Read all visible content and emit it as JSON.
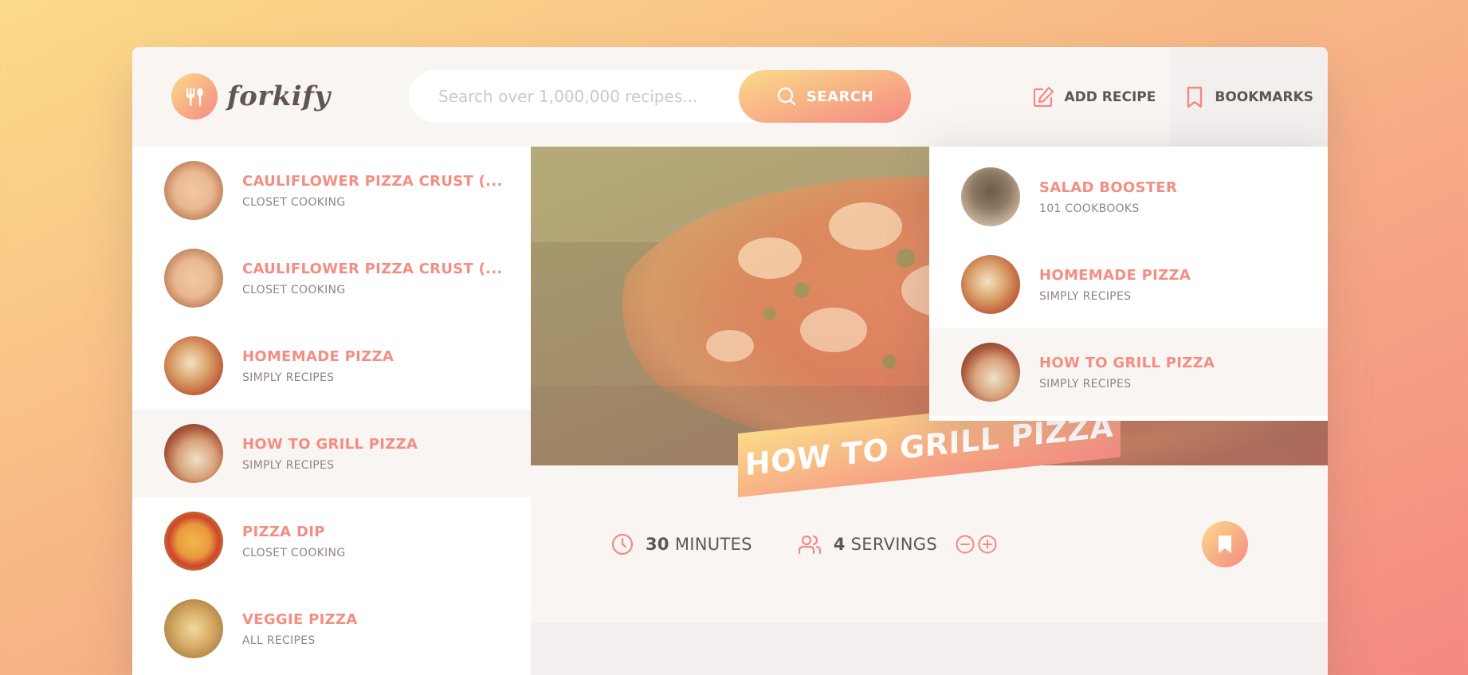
{
  "app": {
    "logo_text": "forkify",
    "search": {
      "placeholder": "Search over 1,000,000 recipes...",
      "button_label": "SEARCH"
    },
    "nav": {
      "add_recipe": "ADD RECIPE",
      "bookmarks": "BOOKMARKS"
    }
  },
  "results": [
    {
      "title": "CAULIFLOWER PIZZA CRUST (...",
      "publisher": "CLOSET COOKING"
    },
    {
      "title": "CAULIFLOWER PIZZA CRUST (...",
      "publisher": "CLOSET COOKING"
    },
    {
      "title": "HOMEMADE PIZZA",
      "publisher": "SIMPLY RECIPES"
    },
    {
      "title": "HOW TO GRILL PIZZA",
      "publisher": "SIMPLY RECIPES"
    },
    {
      "title": "PIZZA DIP",
      "publisher": "CLOSET COOKING"
    },
    {
      "title": "VEGGIE PIZZA",
      "publisher": "ALL RECIPES"
    }
  ],
  "bookmarks": [
    {
      "title": "SALAD BOOSTER",
      "publisher": "101 COOKBOOKS"
    },
    {
      "title": "HOMEMADE PIZZA",
      "publisher": "SIMPLY RECIPES"
    },
    {
      "title": "HOW TO GRILL PIZZA",
      "publisher": "SIMPLY RECIPES"
    }
  ],
  "recipe": {
    "title": "HOW TO GRILL PIZZA",
    "cooking_time": "30",
    "cooking_time_unit": "MINUTES",
    "servings": "4",
    "servings_unit": "SERVINGS"
  },
  "colors": {
    "accent_start": "#fbdb89",
    "accent_end": "#f48982",
    "text": "#615551"
  },
  "icons": [
    "fork-spoon-icon",
    "search-icon",
    "edit-icon",
    "bookmark-icon",
    "clock-icon",
    "users-icon",
    "minus-circle-icon",
    "plus-circle-icon"
  ]
}
